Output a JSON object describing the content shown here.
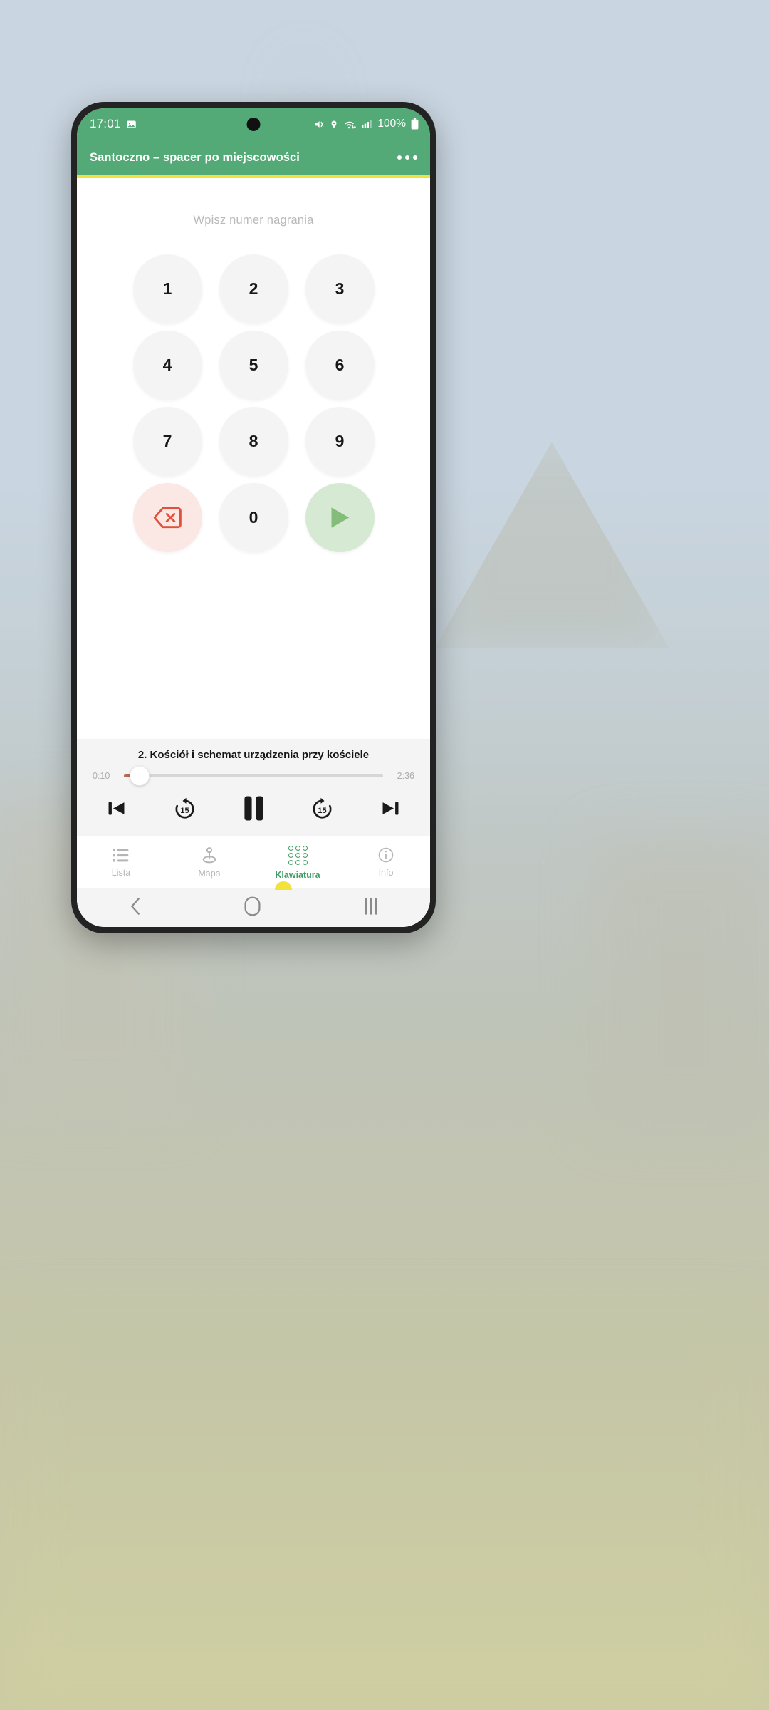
{
  "statusbar": {
    "time": "17:01",
    "battery_percent": "100%",
    "icons": [
      "image-icon",
      "mute-icon",
      "location-icon",
      "wifi-icon",
      "signal-icon",
      "battery-icon"
    ]
  },
  "appbar": {
    "title": "Santoczno – spacer po miejscowości",
    "overflow_label": "",
    "accent_color": "#f2e23c",
    "background_color": "#53aa77"
  },
  "keypad": {
    "hint": "Wpisz numer nagrania",
    "keys": [
      {
        "label": "1",
        "name": "key-1",
        "kind": "digit"
      },
      {
        "label": "2",
        "name": "key-2",
        "kind": "digit"
      },
      {
        "label": "3",
        "name": "key-3",
        "kind": "digit"
      },
      {
        "label": "4",
        "name": "key-4",
        "kind": "digit"
      },
      {
        "label": "5",
        "name": "key-5",
        "kind": "digit"
      },
      {
        "label": "6",
        "name": "key-6",
        "kind": "digit"
      },
      {
        "label": "7",
        "name": "key-7",
        "kind": "digit"
      },
      {
        "label": "8",
        "name": "key-8",
        "kind": "digit"
      },
      {
        "label": "9",
        "name": "key-9",
        "kind": "digit"
      },
      {
        "label": "",
        "name": "key-backspace",
        "kind": "backspace"
      },
      {
        "label": "0",
        "name": "key-0",
        "kind": "digit"
      },
      {
        "label": "",
        "name": "key-play",
        "kind": "play"
      }
    ],
    "backspace_color": "#e0503a",
    "play_color": "#84bd79"
  },
  "player": {
    "track_title": "2. Kościół i schemat urządzenia przy kościele",
    "elapsed": "0:10",
    "duration": "2:36",
    "progress_percent": 6,
    "controls": [
      {
        "name": "previous-track-button",
        "label": "previous-icon"
      },
      {
        "name": "rewind-15-button",
        "label": "15"
      },
      {
        "name": "pause-button",
        "label": "pause-icon"
      },
      {
        "name": "forward-15-button",
        "label": "15"
      },
      {
        "name": "next-track-button",
        "label": "next-icon"
      }
    ]
  },
  "bottomnav": {
    "items": [
      {
        "label": "Lista",
        "name": "nav-lista",
        "icon": "list-icon",
        "active": false
      },
      {
        "label": "Mapa",
        "name": "nav-mapa",
        "icon": "map-pin-icon",
        "active": false
      },
      {
        "label": "Klawiatura",
        "name": "nav-klawiatura",
        "icon": "keypad-dots-icon",
        "active": true
      },
      {
        "label": "Info",
        "name": "nav-info",
        "icon": "info-icon",
        "active": false
      }
    ],
    "active_color": "#3f9e62"
  },
  "sysnav": {
    "buttons": [
      "back-icon",
      "home-icon",
      "recents-icon"
    ]
  }
}
